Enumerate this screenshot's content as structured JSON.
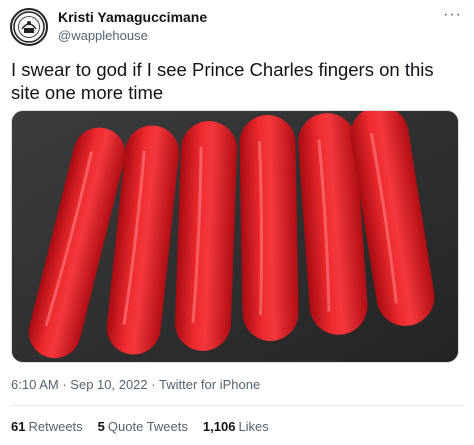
{
  "author": {
    "name": "Kristi Yamaguccimane",
    "handle": "@wapplehouse"
  },
  "more_icon": "more-horizontal-icon",
  "tweet": {
    "text": "I swear to god if I see Prince Charles fingers on this site one more time"
  },
  "media": {
    "subject": "sausages",
    "colors": {
      "background": "#2e2e2e",
      "sausage": "#e0141b"
    }
  },
  "meta": {
    "time": "6:10 AM",
    "date": "Sep 10, 2022",
    "source": "Twitter for iPhone",
    "separator": "·"
  },
  "stats": {
    "retweets": {
      "count": "61",
      "label": "Retweets"
    },
    "quote_tweets": {
      "count": "5",
      "label": "Quote Tweets"
    },
    "likes": {
      "count": "1,106",
      "label": "Likes"
    }
  }
}
